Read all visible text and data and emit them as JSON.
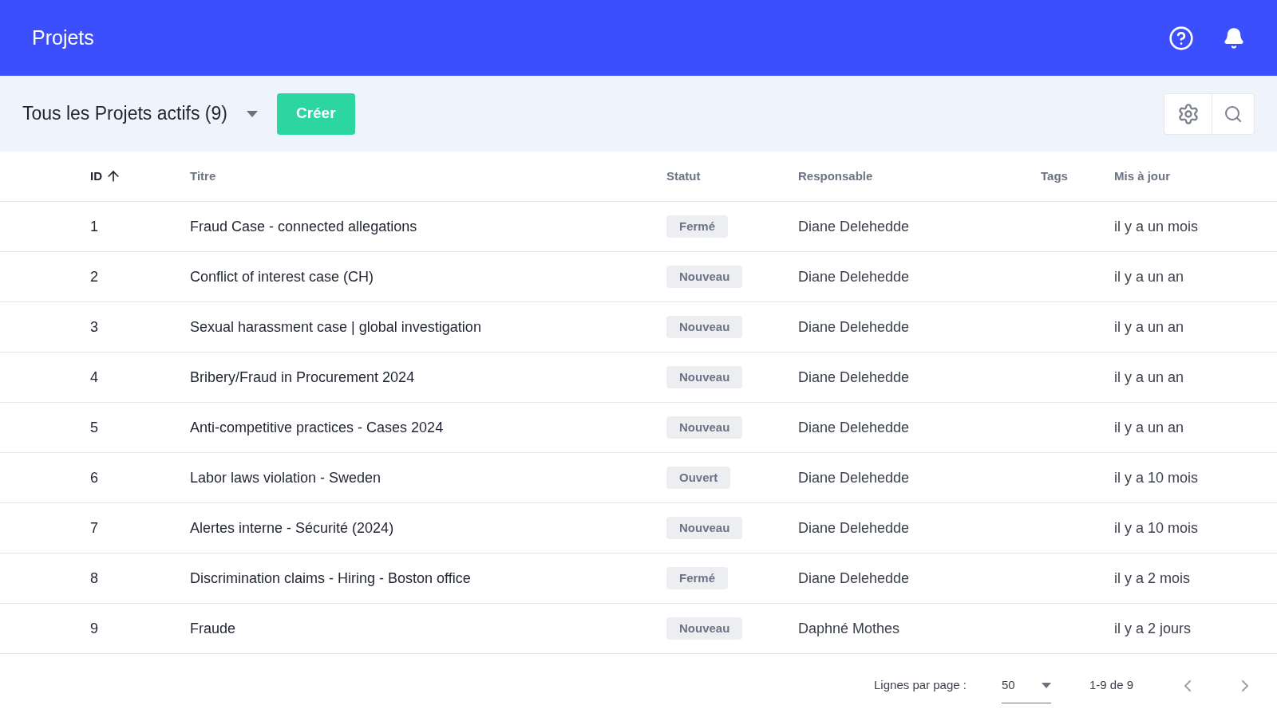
{
  "header": {
    "title": "Projets"
  },
  "toolbar": {
    "view": "Tous les Projets actifs (9)",
    "create_button": "Créer"
  },
  "table": {
    "columns": [
      {
        "label": "ID",
        "sorted": true
      },
      {
        "label": "Titre",
        "sorted": false
      },
      {
        "label": "Statut",
        "sorted": false
      },
      {
        "label": "Responsable",
        "sorted": false
      },
      {
        "label": "Tags",
        "sorted": false
      },
      {
        "label": "Mis à jour",
        "sorted": false
      }
    ],
    "rows": [
      {
        "id": "1",
        "title": "Fraud Case - connected allegations",
        "status": "Fermé",
        "owner": "Diane Delehedde",
        "updated": "il y a un mois"
      },
      {
        "id": "2",
        "title": "Conflict of interest case (CH)",
        "status": "Nouveau",
        "owner": "Diane Delehedde",
        "updated": "il y a un an"
      },
      {
        "id": "3",
        "title": "Sexual harassment case | global investigation",
        "status": "Nouveau",
        "owner": "Diane Delehedde",
        "updated": "il y a un an"
      },
      {
        "id": "4",
        "title": "Bribery/Fraud in Procurement 2024",
        "status": "Nouveau",
        "owner": "Diane Delehedde",
        "updated": "il y a un an"
      },
      {
        "id": "5",
        "title": "Anti-competitive practices - Cases 2024",
        "status": "Nouveau",
        "owner": "Diane Delehedde",
        "updated": "il y a un an"
      },
      {
        "id": "6",
        "title": "Labor laws violation - Sweden",
        "status": "Ouvert",
        "owner": "Diane Delehedde",
        "updated": "il y a 10 mois"
      },
      {
        "id": "7",
        "title": "Alertes interne - Sécurité (2024)",
        "status": "Nouveau",
        "owner": "Diane Delehedde",
        "updated": "il y a 10 mois"
      },
      {
        "id": "8",
        "title": "Discrimination claims - Hiring - Boston office",
        "status": "Fermé",
        "owner": "Diane Delehedde",
        "updated": "il y a 2 mois"
      },
      {
        "id": "9",
        "title": "Fraude",
        "status": "Nouveau",
        "owner": "Daphné Mothes",
        "updated": "il y a 2 jours"
      }
    ]
  },
  "pagination": {
    "rows_per_page_label": "Lignes par page :",
    "rows_per_page": "50",
    "range": "1-9 de 9"
  }
}
